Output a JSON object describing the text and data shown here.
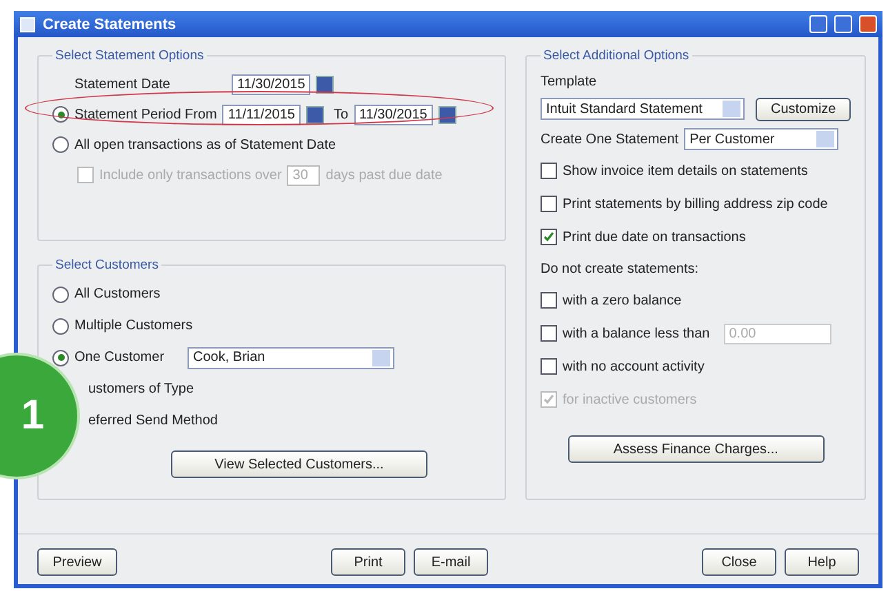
{
  "window": {
    "title": "Create Statements"
  },
  "statement_options": {
    "title": "Select Statement Options",
    "date_label": "Statement Date",
    "date_value": "11/30/2015",
    "choices": [
      {
        "kind": "period",
        "label": "Statement Period From",
        "selected": true,
        "from": "11/11/2015",
        "to_label": "To",
        "to": "11/30/2015"
      },
      {
        "kind": "plain",
        "label": "All open transactions as of Statement Date",
        "selected": false
      }
    ],
    "include": {
      "before": "Include only transactions over",
      "value": "30",
      "after": "days past due date",
      "checked": false,
      "disabled": true
    }
  },
  "customers": {
    "title": "Select Customers",
    "choices": [
      {
        "kind": "plain",
        "label": "All Customers",
        "selected": false
      },
      {
        "kind": "plain",
        "label": "Multiple Customers",
        "selected": false
      },
      {
        "kind": "combo",
        "label": "One Customer",
        "selected": true,
        "value": "Cook, Brian"
      },
      {
        "kind": "covered",
        "label": "ustomers of Type"
      },
      {
        "kind": "covered",
        "label": "eferred Send Method"
      }
    ],
    "view_button": "View Selected Customers..."
  },
  "additional": {
    "title": "Select Additional Options",
    "template_label": "Template",
    "template_value": "Intuit Standard Statement",
    "customize_button": "Customize",
    "create_label": "Create One Statement",
    "create_value": "Per Customer",
    "checkboxes": [
      {
        "label": "Show invoice item details on statements",
        "checked": false,
        "disabled": false
      },
      {
        "label": "Print statements by billing address zip code",
        "checked": false,
        "disabled": false
      },
      {
        "label": "Print due date on transactions",
        "checked": true,
        "disabled": false
      }
    ],
    "do_not_label": "Do not create statements:",
    "do_not": [
      {
        "label": "with a zero balance",
        "checked": false,
        "disabled": false
      },
      {
        "label": "with a balance less than",
        "checked": false,
        "disabled": false,
        "field": "0.00"
      },
      {
        "label": "with no account activity",
        "checked": false,
        "disabled": false
      },
      {
        "label": "for inactive customers",
        "checked": true,
        "disabled": true
      }
    ],
    "assess_button": "Assess Finance Charges..."
  },
  "footer": {
    "left": [
      "Preview"
    ],
    "middle": [
      "Print",
      "E-mail"
    ],
    "right": [
      "Close",
      "Help"
    ]
  },
  "badge": {
    "text": "1"
  }
}
